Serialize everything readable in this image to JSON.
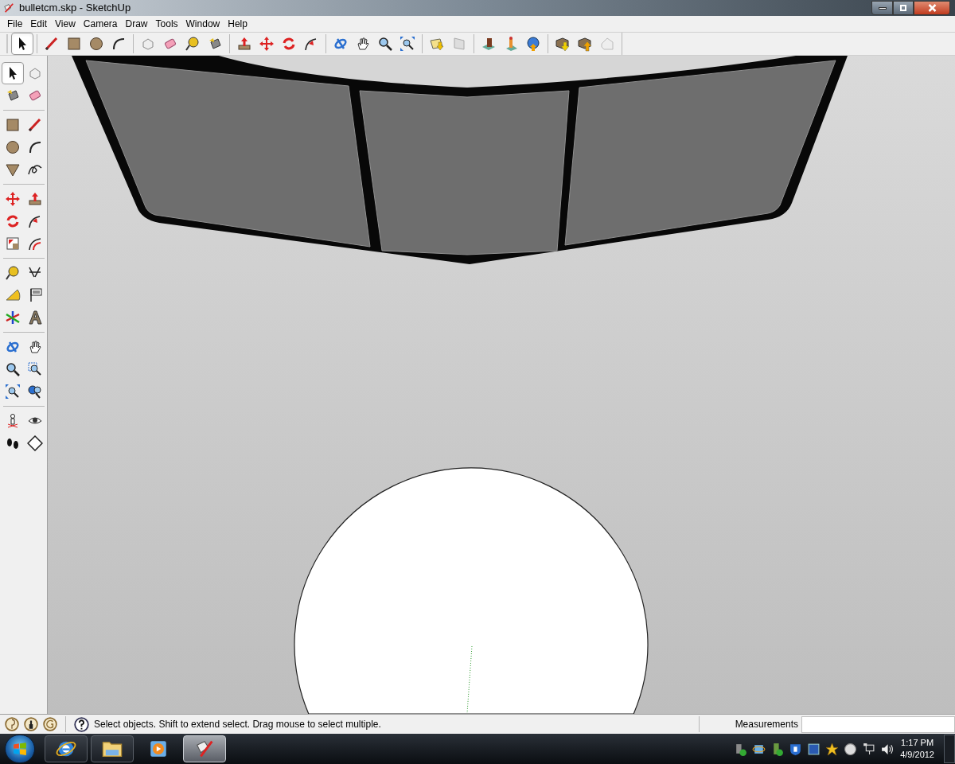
{
  "window": {
    "title": "bulletcm.skp - SketchUp"
  },
  "menu": [
    {
      "label": "File"
    },
    {
      "label": "Edit"
    },
    {
      "label": "View"
    },
    {
      "label": "Camera"
    },
    {
      "label": "Draw"
    },
    {
      "label": "Tools"
    },
    {
      "label": "Window"
    },
    {
      "label": "Help"
    }
  ],
  "main_toolbar": {
    "select_tool": {
      "selected": true
    }
  },
  "side_toolbar": {
    "select_tool": {
      "selected": true
    }
  },
  "status_bar": {
    "hint": "Select objects. Shift to extend select. Drag mouse to select multiple.",
    "measurements_label": "Measurements"
  },
  "taskbar": {
    "apps": [
      {
        "kind": "browser",
        "running": true,
        "selected": false
      },
      {
        "kind": "files",
        "running": true,
        "selected": false
      },
      {
        "kind": "media",
        "running": false,
        "selected": false
      },
      {
        "kind": "sketchup",
        "running": true,
        "selected": true
      }
    ],
    "clock": {
      "time": "1:17 PM",
      "date": "4/9/2012"
    }
  }
}
